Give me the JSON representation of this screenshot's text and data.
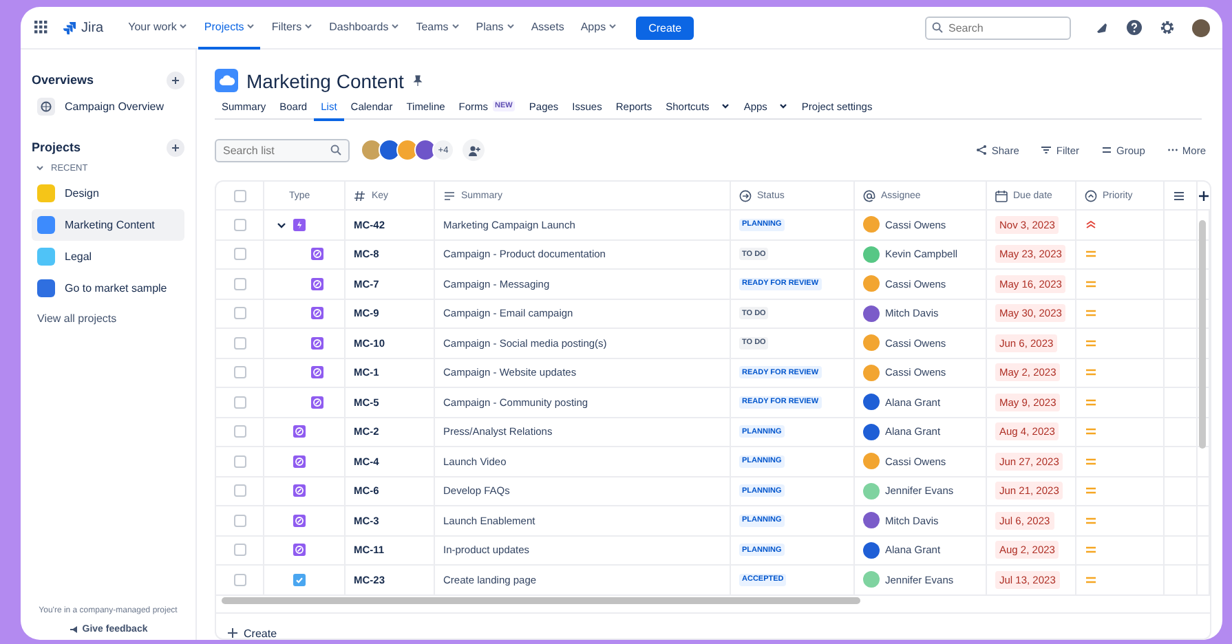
{
  "topnav": {
    "product": "Jira",
    "items": [
      {
        "label": "Your work",
        "menu": true,
        "selected": false
      },
      {
        "label": "Projects",
        "menu": true,
        "selected": true
      },
      {
        "label": "Filters",
        "menu": true,
        "selected": false
      },
      {
        "label": "Dashboards",
        "menu": true,
        "selected": false
      },
      {
        "label": "Teams",
        "menu": true,
        "selected": false
      },
      {
        "label": "Plans",
        "menu": true,
        "selected": false
      },
      {
        "label": "Assets",
        "menu": false,
        "selected": false
      },
      {
        "label": "Apps",
        "menu": true,
        "selected": false
      }
    ],
    "create": "Create",
    "search": {
      "placeholder": "Search"
    }
  },
  "sidebar": {
    "overviews": {
      "title": "Overviews",
      "items": [
        {
          "label": "Campaign Overview"
        }
      ]
    },
    "projects": {
      "title": "Projects",
      "group": "RECENT",
      "expanded": true,
      "items": [
        {
          "label": "Design",
          "color": "#f5c518",
          "selected": false
        },
        {
          "label": "Marketing Content",
          "color": "#3d8bfd",
          "selected": true
        },
        {
          "label": "Legal",
          "color": "#4fc3f7",
          "selected": false
        },
        {
          "label": "Go to market sample",
          "color": "#2f6fe0",
          "selected": false
        }
      ],
      "more": "View all projects"
    },
    "footer": "You're in a company-managed project",
    "feedback": "Give feedback"
  },
  "project": {
    "title": "Marketing Content",
    "tabs": [
      {
        "label": "Summary",
        "selected": false
      },
      {
        "label": "Board",
        "selected": false
      },
      {
        "label": "List",
        "selected": true
      },
      {
        "label": "Calendar",
        "selected": false
      },
      {
        "label": "Timeline",
        "selected": false
      },
      {
        "label": "Forms",
        "badge": "NEW",
        "selected": false
      },
      {
        "label": "Pages",
        "selected": false
      },
      {
        "label": "Issues",
        "selected": false
      },
      {
        "label": "Reports",
        "selected": false
      },
      {
        "label": "Shortcuts",
        "menu": true,
        "selected": false
      },
      {
        "label": "Apps",
        "menu": true,
        "selected": false
      },
      {
        "label": "Project settings",
        "selected": false
      }
    ]
  },
  "toolbar": {
    "search": {
      "placeholder": "Search list"
    },
    "avatars": [
      {
        "color": "#c9a25a"
      },
      {
        "color": "#1f5fd6"
      },
      {
        "color": "#f2a531"
      },
      {
        "color": "#6e55c9"
      }
    ],
    "more_people": "+4",
    "actions": [
      {
        "kind": "share",
        "label": "Share"
      },
      {
        "kind": "filter",
        "label": "Filter"
      },
      {
        "kind": "group",
        "label": "Group"
      },
      {
        "kind": "more",
        "label": "More"
      }
    ]
  },
  "table": {
    "columns": [
      {
        "kind": "check",
        "checked": false
      },
      {
        "kind": "type",
        "label": "Type"
      },
      {
        "kind": "key",
        "label": "Key"
      },
      {
        "kind": "summary",
        "label": "Summary"
      },
      {
        "kind": "status",
        "label": "Status"
      },
      {
        "kind": "assignee",
        "label": "Assignee"
      },
      {
        "kind": "due",
        "label": "Due date"
      },
      {
        "kind": "priority",
        "label": "Priority"
      },
      {
        "kind": "cut"
      }
    ],
    "rows": [
      {
        "issue_type": {
          "kind": "epic"
        },
        "key": "MC-42",
        "summary": "Marketing Campaign Launch",
        "status": {
          "label": "PLANNING",
          "kind": "progress"
        },
        "assignee": {
          "name": "Cassi Owens",
          "color": "#f2a531"
        },
        "due": "Nov 3, 2023",
        "priority": {
          "kind": "highest"
        },
        "checked": false,
        "expanded": true,
        "children": [
          {
            "issue_type": {
              "kind": "subtask"
            },
            "key": "MC-8",
            "summary": "Campaign - Product documentation",
            "status": {
              "label": "TO DO",
              "kind": "todo"
            },
            "assignee": {
              "name": "Kevin Campbell",
              "color": "#57c785"
            },
            "due": "May 23, 2023",
            "priority": {
              "kind": "medium"
            },
            "checked": false
          },
          {
            "issue_type": {
              "kind": "subtask"
            },
            "key": "MC-7",
            "summary": "Campaign - Messaging",
            "status": {
              "label": "READY FOR REVIEW",
              "kind": "progress"
            },
            "assignee": {
              "name": "Cassi Owens",
              "color": "#f2a531"
            },
            "due": "May 16, 2023",
            "priority": {
              "kind": "medium"
            },
            "checked": false
          },
          {
            "issue_type": {
              "kind": "subtask"
            },
            "key": "MC-9",
            "summary": "Campaign - Email campaign",
            "status": {
              "label": "TO DO",
              "kind": "todo"
            },
            "assignee": {
              "name": "Mitch Davis",
              "color": "#7b5cc9"
            },
            "due": "May 30, 2023",
            "priority": {
              "kind": "medium"
            },
            "checked": false
          },
          {
            "issue_type": {
              "kind": "subtask"
            },
            "key": "MC-10",
            "summary": "Campaign - Social media posting(s)",
            "status": {
              "label": "TO DO",
              "kind": "todo"
            },
            "assignee": {
              "name": "Cassi Owens",
              "color": "#f2a531"
            },
            "due": "Jun 6, 2023",
            "priority": {
              "kind": "medium"
            },
            "checked": false
          },
          {
            "issue_type": {
              "kind": "subtask"
            },
            "key": "MC-1",
            "summary": "Campaign - Website updates",
            "status": {
              "label": "READY FOR REVIEW",
              "kind": "progress"
            },
            "assignee": {
              "name": "Cassi Owens",
              "color": "#f2a531"
            },
            "due": "May 2, 2023",
            "priority": {
              "kind": "medium"
            },
            "checked": false
          },
          {
            "issue_type": {
              "kind": "subtask"
            },
            "key": "MC-5",
            "summary": "Campaign - Community posting",
            "status": {
              "label": "READY FOR REVIEW",
              "kind": "progress"
            },
            "assignee": {
              "name": "Alana Grant",
              "color": "#1f5fd6"
            },
            "due": "May 9, 2023",
            "priority": {
              "kind": "medium"
            },
            "checked": false
          }
        ]
      },
      {
        "issue_type": {
          "kind": "subtask"
        },
        "key": "MC-2",
        "summary": "Press/Analyst Relations",
        "status": {
          "label": "PLANNING",
          "kind": "progress"
        },
        "assignee": {
          "name": "Alana Grant",
          "color": "#1f5fd6"
        },
        "due": "Aug 4, 2023",
        "priority": {
          "kind": "medium"
        },
        "checked": false
      },
      {
        "issue_type": {
          "kind": "subtask"
        },
        "key": "MC-4",
        "summary": "Launch Video",
        "status": {
          "label": "PLANNING",
          "kind": "progress"
        },
        "assignee": {
          "name": "Cassi Owens",
          "color": "#f2a531"
        },
        "due": "Jun 27, 2023",
        "priority": {
          "kind": "medium"
        },
        "checked": false
      },
      {
        "issue_type": {
          "kind": "subtask"
        },
        "key": "MC-6",
        "summary": "Develop FAQs",
        "status": {
          "label": "PLANNING",
          "kind": "progress"
        },
        "assignee": {
          "name": "Jennifer Evans",
          "color": "#7fd3a0"
        },
        "due": "Jun 21, 2023",
        "priority": {
          "kind": "medium"
        },
        "checked": false
      },
      {
        "issue_type": {
          "kind": "subtask"
        },
        "key": "MC-3",
        "summary": "Launch Enablement",
        "status": {
          "label": "PLANNING",
          "kind": "progress"
        },
        "assignee": {
          "name": "Mitch Davis",
          "color": "#7b5cc9"
        },
        "due": "Jul 6, 2023",
        "priority": {
          "kind": "medium"
        },
        "checked": false
      },
      {
        "issue_type": {
          "kind": "subtask"
        },
        "key": "MC-11",
        "summary": "In-product updates",
        "status": {
          "label": "PLANNING",
          "kind": "progress"
        },
        "assignee": {
          "name": "Alana Grant",
          "color": "#1f5fd6"
        },
        "due": "Aug 2, 2023",
        "priority": {
          "kind": "medium"
        },
        "checked": false
      },
      {
        "issue_type": {
          "kind": "task"
        },
        "key": "MC-23",
        "summary": "Create landing page",
        "status": {
          "label": "ACCEPTED",
          "kind": "progress"
        },
        "assignee": {
          "name": "Jennifer Evans",
          "color": "#7fd3a0"
        },
        "due": "Jul 13, 2023",
        "priority": {
          "kind": "medium"
        },
        "checked": false
      }
    ]
  },
  "create_row": "Create"
}
